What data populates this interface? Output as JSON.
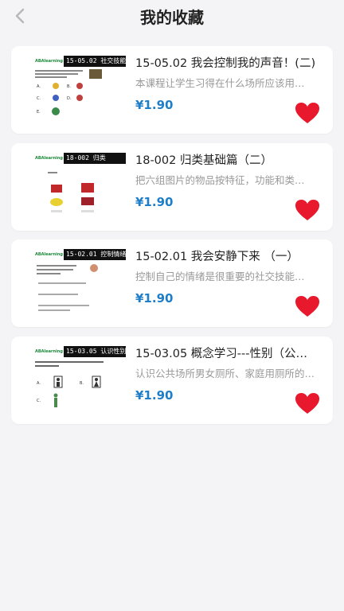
{
  "header": {
    "title": "我的收藏",
    "back_icon": "chevron-left-icon"
  },
  "colors": {
    "price": "#1e7ec8",
    "heart": "#e8182d",
    "thumb_code_bg": "#111111",
    "logo": "#1a8a3a"
  },
  "favorites": [
    {
      "title": "15-05.02 我会控制我的声音！(二)",
      "description": "本课程让学生习得在什么场所应该用…",
      "price": "¥1.90",
      "thumb_code": "15-05.02 社交技能",
      "thumb_logo": "ABAlearning"
    },
    {
      "title": "18-002 归类基础篇（二）",
      "description": "把六组图片的物品按特征，功能和类…",
      "price": "¥1.90",
      "thumb_code": "18-002 归类",
      "thumb_logo": "ABAlearning"
    },
    {
      "title": "15-02.01 我会安静下来 （一）",
      "description": "控制自己的情绪是很重要的社交技能…",
      "price": "¥1.90",
      "thumb_code": "15-02.01 控制情绪",
      "thumb_logo": "ABAlearning"
    },
    {
      "title": "15-03.05 概念学习---性别（公…",
      "description": "认识公共场所男女厕所、家庭用厕所的…",
      "price": "¥1.90",
      "thumb_code": "15-03.05 认识性别",
      "thumb_logo": "ABAlearning"
    }
  ]
}
